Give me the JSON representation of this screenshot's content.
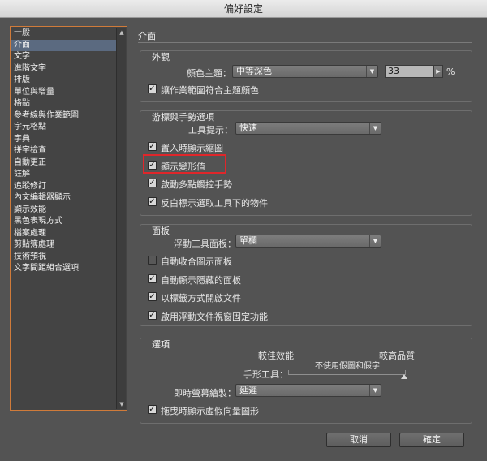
{
  "window": {
    "title": "偏好設定"
  },
  "sidebar": {
    "items": [
      {
        "label": "一般",
        "selected": false
      },
      {
        "label": "介面",
        "selected": true
      },
      {
        "label": "文字",
        "selected": false
      },
      {
        "label": "進階文字",
        "selected": false
      },
      {
        "label": "排版",
        "selected": false
      },
      {
        "label": "單位與增量",
        "selected": false
      },
      {
        "label": "格點",
        "selected": false
      },
      {
        "label": "參考線與作業範圍",
        "selected": false
      },
      {
        "label": "字元格點",
        "selected": false
      },
      {
        "label": "字典",
        "selected": false
      },
      {
        "label": "拼字檢查",
        "selected": false
      },
      {
        "label": "自動更正",
        "selected": false
      },
      {
        "label": "註解",
        "selected": false
      },
      {
        "label": "追蹤修訂",
        "selected": false
      },
      {
        "label": "內文編輯器顯示",
        "selected": false
      },
      {
        "label": "顯示效能",
        "selected": false
      },
      {
        "label": "黑色表現方式",
        "selected": false
      },
      {
        "label": "檔案處理",
        "selected": false
      },
      {
        "label": "剪貼簿處理",
        "selected": false
      },
      {
        "label": "技術預視",
        "selected": false
      },
      {
        "label": "文字間距組合選項",
        "selected": false
      }
    ]
  },
  "main": {
    "title": "介面",
    "appearance": {
      "title": "外觀",
      "theme_label": "顏色主題：",
      "theme_value": "中等深色",
      "brightness_value": "33",
      "percent_sign": "%",
      "match_pasteboard_label": "讓作業範圍符合主題顏色",
      "match_pasteboard_checked": true
    },
    "cursor": {
      "title": "游標與手勢選項",
      "tooltips_label": "工具提示：",
      "tooltips_value": "快速",
      "options": [
        {
          "label": "置入時顯示縮圖",
          "checked": true
        },
        {
          "label": "顯示變形值",
          "checked": true
        },
        {
          "label": "啟動多點觸控手勢",
          "checked": true
        },
        {
          "label": "反白標示選取工具下的物件",
          "checked": true
        }
      ]
    },
    "panels": {
      "title": "面板",
      "floating_label": "浮動工具面板：",
      "floating_value": "單欄",
      "options": [
        {
          "label": "自動收合圖示面板",
          "checked": false
        },
        {
          "label": "自動顯示隱藏的面板",
          "checked": true
        },
        {
          "label": "以標籤方式開啟文件",
          "checked": true
        },
        {
          "label": "啟用浮動文件視窗固定功能",
          "checked": true
        }
      ]
    },
    "options": {
      "title": "選項",
      "better_performance": "較佳效能",
      "higher_quality": "較高品質",
      "hand_tool_label": "手形工具：",
      "hand_tool_value": "不使用假圖和假字",
      "live_redraw_label": "即時螢幕繪製：",
      "live_redraw_value": "延遲",
      "greek_vector_label": "拖曳時顯示虛假向量圖形",
      "greek_vector_checked": true
    }
  },
  "buttons": {
    "cancel": "取消",
    "ok": "確定"
  },
  "colors": {
    "highlight": "#e0262a",
    "selection": "#5b6a80",
    "sidebar_border": "#d07b3a"
  },
  "icons": {
    "dropdown": "chevron-down-icon",
    "checkbox": "check-icon"
  }
}
